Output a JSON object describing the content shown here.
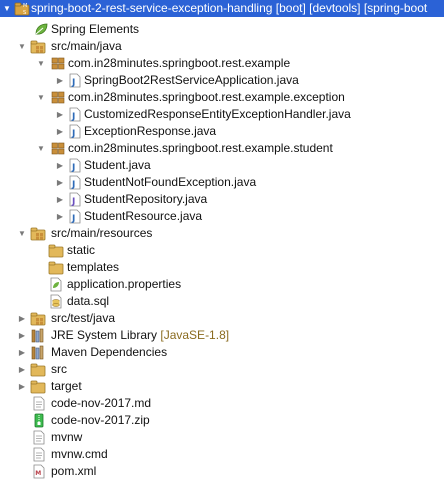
{
  "project": {
    "name": "spring-boot-2-rest-service-exception-handling",
    "decorations": "[boot] [devtools] [spring-boot",
    "badge": "M S"
  },
  "items": [
    {
      "label": "Spring Elements",
      "icon": "spring-elements-icon"
    },
    {
      "label": "src/main/java",
      "icon": "source-folder-icon"
    },
    {
      "label": "com.in28minutes.springboot.rest.example",
      "icon": "package-icon"
    },
    {
      "label": "SpringBoot2RestServiceApplication.java",
      "icon": "java-file-icon"
    },
    {
      "label": "com.in28minutes.springboot.rest.example.exception",
      "icon": "package-icon"
    },
    {
      "label": "CustomizedResponseEntityExceptionHandler.java",
      "icon": "java-file-icon"
    },
    {
      "label": "ExceptionResponse.java",
      "icon": "java-file-icon"
    },
    {
      "label": "com.in28minutes.springboot.rest.example.student",
      "icon": "package-icon"
    },
    {
      "label": "Student.java",
      "icon": "java-file-icon"
    },
    {
      "label": "StudentNotFoundException.java",
      "icon": "java-file-icon"
    },
    {
      "label": "StudentRepository.java",
      "icon": "java-interface-file-icon"
    },
    {
      "label": "StudentResource.java",
      "icon": "java-file-icon"
    },
    {
      "label": "src/main/resources",
      "icon": "source-folder-icon"
    },
    {
      "label": "static",
      "icon": "folder-icon"
    },
    {
      "label": "templates",
      "icon": "folder-icon"
    },
    {
      "label": "application.properties",
      "icon": "properties-file-icon"
    },
    {
      "label": "data.sql",
      "icon": "sql-file-icon"
    },
    {
      "label": "src/test/java",
      "icon": "source-folder-icon"
    },
    {
      "label": "JRE System Library",
      "decoration": "[JavaSE-1.8]",
      "icon": "library-icon"
    },
    {
      "label": "Maven Dependencies",
      "icon": "library-icon"
    },
    {
      "label": "src",
      "icon": "folder-icon"
    },
    {
      "label": "target",
      "icon": "folder-icon"
    },
    {
      "label": "code-nov-2017.md",
      "icon": "text-file-icon"
    },
    {
      "label": "code-nov-2017.zip",
      "icon": "zip-file-icon"
    },
    {
      "label": "mvnw",
      "icon": "text-file-icon"
    },
    {
      "label": "mvnw.cmd",
      "icon": "text-file-icon"
    },
    {
      "label": "pom.xml",
      "icon": "xml-file-icon"
    }
  ],
  "colors": {
    "selection": "#2b62d6",
    "decoration": "#8a6b1f",
    "folder": "#e2b85a",
    "package": "#c98f3a",
    "java_class": "#2e8b3a",
    "java_interface": "#6b4fbf"
  }
}
